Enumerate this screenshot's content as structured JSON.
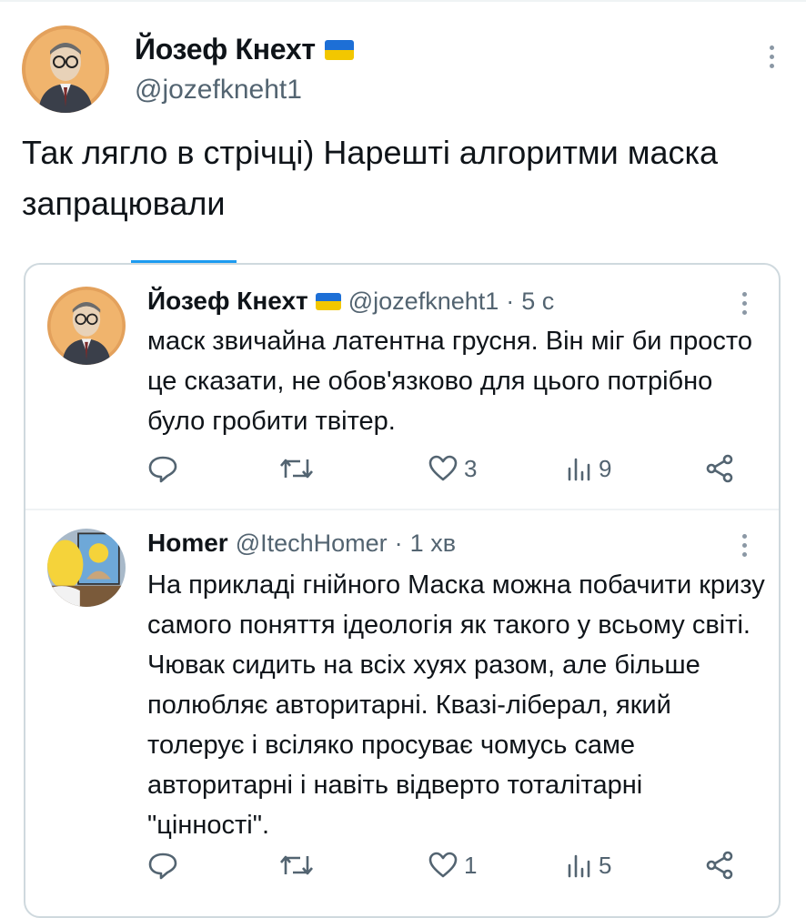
{
  "header": {
    "display_name": "Йозеф Кнехт",
    "handle": "@jozefkneht1",
    "flag_colors": {
      "top": "#1d6fd6",
      "bottom": "#f2c700"
    },
    "more_icon": "more-vertical-icon"
  },
  "tweet": {
    "text": "Так лягло в стрічці) Нарешті алгоритми маска запрацювали"
  },
  "quoted": [
    {
      "display_name": "Йозеф Кнехт",
      "handle": "@jozefkneht1",
      "separator": "·",
      "time": "5 с",
      "text": "маск звичайна латентна грусня. Він міг би просто це сказати, не обов'язково для цього потрібно було гробити твітер.",
      "actions": {
        "reply": "",
        "retweet": "",
        "likes": "3",
        "views": "9"
      }
    },
    {
      "display_name": "Homer",
      "handle": "@ItechHomer",
      "separator": "·",
      "time": "1 хв",
      "text": "На прикладі гнійного Маска можна побачити кризу самого поняття ідеологія як такого у всьому світі. Чювак сидить на всіх хуях разом, але більше полюбляє авторитарні. Квазі-ліберал, який толерує і всіляко просуває чомусь саме авторитарні і навіть відверто тоталітарні \"цінності\".",
      "actions": {
        "reply": "",
        "retweet": "",
        "likes": "1",
        "views": "5"
      }
    }
  ],
  "colors": {
    "accent": "#1d9bf0",
    "secondary_text": "#536471",
    "border": "#cfd9de"
  }
}
